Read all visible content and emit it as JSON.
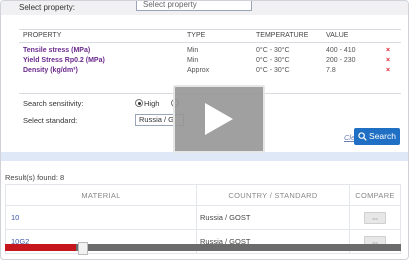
{
  "top": {
    "select_property_label": "Select property:",
    "select_property_value": "Select property"
  },
  "properties": {
    "headers": [
      "PROPERTY",
      "TYPE",
      "TEMPERATURE",
      "VALUE"
    ],
    "rows": [
      {
        "property": "Tensile stress (MPa)",
        "type": "Min",
        "temperature": "0°C - 30°C",
        "value": "400 - 410"
      },
      {
        "property": "Yield Stress Rp0.2 (MPa)",
        "type": "Min",
        "temperature": "0°C - 30°C",
        "value": "200 - 230"
      },
      {
        "property": "Density (kg/dm³)",
        "type": "Approx",
        "temperature": "0°C - 30°C",
        "value": "7.8"
      }
    ],
    "delete_glyph": "×"
  },
  "search": {
    "sensitivity_label": "Search sensitivity:",
    "sensitivity_selected": "High",
    "standard_label": "Select standard:",
    "standard_value": "Russia / G",
    "clear_label": "Clear",
    "search_label": "Search"
  },
  "results": {
    "count_text": "Result(s) found: 8",
    "headers": [
      "MATERIAL",
      "COUNTRY / STANDARD",
      "COMPARE"
    ],
    "rows": [
      {
        "material": "10",
        "standard": "Russia / GOST",
        "compare_glyph": "⇔"
      },
      {
        "material": "10G2",
        "standard": "Russia / GOST",
        "compare_glyph": "⇔"
      }
    ],
    "scroll_position": 0.18
  },
  "colors": {
    "accent": "#1f6fc4",
    "delete": "#d9232d",
    "scroll_fill": "#c4161c"
  },
  "icons": {
    "play": "play-icon",
    "search": "search-icon",
    "compare": "compare-arrows-icon",
    "delete": "delete-x-icon"
  }
}
